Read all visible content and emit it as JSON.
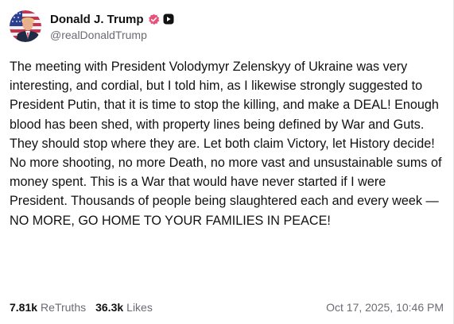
{
  "post": {
    "author": {
      "display_name": "Donald J. Trump",
      "handle": "@realDonaldTrump",
      "verified_icon": "verified-badge-icon",
      "secondary_badge_icon": "truth-social-badge-icon"
    },
    "body": "The meeting with President Volodymyr Zelenskyy of Ukraine was very interesting, and cordial, but I told him, as I likewise strongly suggested to President Putin, that it is time to stop the killing, and make a DEAL! Enough blood has been shed, with property lines being defined by War and Guts. They should stop where they are. Let both claim Victory, let History decide! No more shooting, no more Death, no more vast and unsustainable sums of money spent. This is a War that would have never started if I were President. Thousands of people being slaughtered each and every week — NO MORE, GO HOME TO YOUR FAMILIES IN PEACE!",
    "stats": {
      "retruths_count": "7.81k",
      "retruths_label": "ReTruths",
      "likes_count": "36.3k",
      "likes_label": "Likes"
    },
    "timestamp": "Oct 17, 2025, 10:46 PM"
  },
  "colors": {
    "verified_accent": "#e8527a",
    "secondary_text": "#6b6b72",
    "primary_text": "#111111"
  }
}
